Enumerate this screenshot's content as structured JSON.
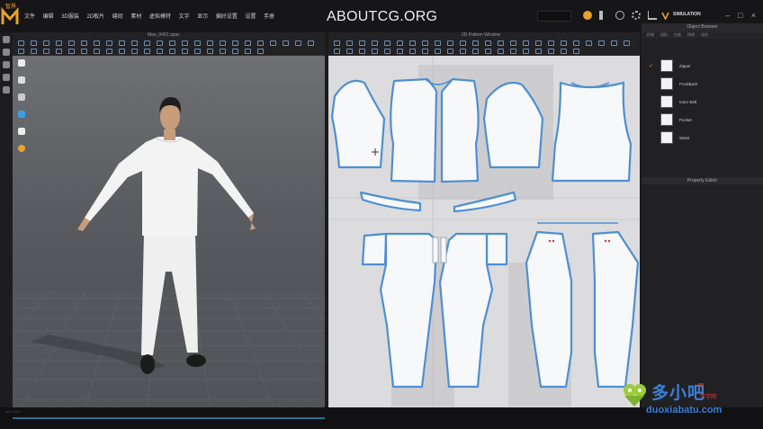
{
  "app": {
    "logo_text": "智界",
    "watermark": "ABOUTCG.ORG",
    "simulation_label": "SIMULATION"
  },
  "menu": [
    "文件",
    "编辑",
    "3D服装",
    "2D板片",
    "缝纫",
    "素材",
    "虚拟模特",
    "文字",
    "显示",
    "偏好设置",
    "设置",
    "手册"
  ],
  "viewports": {
    "left_title": "Man_0401.zpac",
    "right_title": "2D Pattern Window"
  },
  "object_browser": {
    "title": "Object Browser",
    "tabs": [
      "织物",
      "纽扣",
      "拉链",
      "明线",
      "花纹"
    ],
    "fabrics": [
      {
        "label": "Zipper",
        "selected": true
      },
      {
        "label": "FrontBack",
        "selected": false
      },
      {
        "label": "Inner Belt",
        "selected": false
      },
      {
        "label": "Pocket",
        "selected": false
      },
      {
        "label": "Waist",
        "selected": false
      }
    ]
  },
  "property_editor": {
    "title": "Property Editor"
  },
  "status": {
    "text": "Ver 4.0.0 ..."
  },
  "brand_overlay": {
    "main": "多小吧",
    "tag1": "网",
    "tag2": "学学网",
    "url": "duoxiabatu.com"
  },
  "colors": {
    "accent": "#e8a12a",
    "pattern_outline": "#4f8fd0",
    "pattern_fill": "#f7f8fa",
    "background_2d": "#dcdcde",
    "garment": "#f0f0f0"
  },
  "icons": [
    "logo-icon",
    "coin-icon",
    "speaker-icon",
    "user-icon",
    "gear-icon",
    "cart-icon",
    "settings-icon",
    "minimize-icon",
    "maximize-icon",
    "close-icon"
  ]
}
